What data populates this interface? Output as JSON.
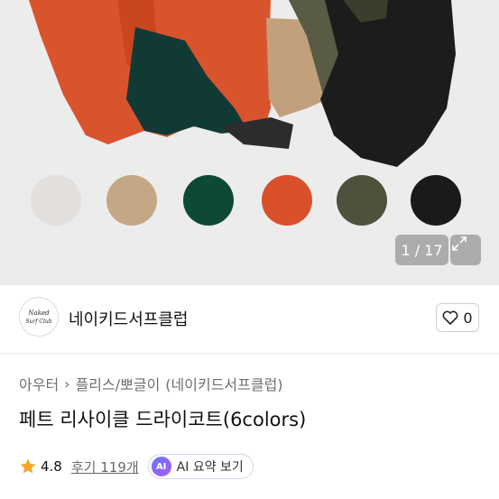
{
  "gallery": {
    "counter": "1 / 17",
    "swatches": [
      {
        "name": "light-gray",
        "color": "#e2dfdc"
      },
      {
        "name": "beige",
        "color": "#c4a784"
      },
      {
        "name": "green",
        "color": "#0e4a33"
      },
      {
        "name": "orange",
        "color": "#d9502b"
      },
      {
        "name": "khaki",
        "color": "#4e513c"
      },
      {
        "name": "black",
        "color": "#1a1a1a"
      }
    ],
    "expand_icon": "expand-icon"
  },
  "shop": {
    "name": "네이키드서프클럽",
    "logo_text": "Naked Surf Club",
    "like_count": "0"
  },
  "product": {
    "breadcrumb": [
      "아우터",
      "플리스/뽀글이",
      "(네이키드서프클럽)"
    ],
    "title": "페트 리사이클 드라이코트(6colors)",
    "rating": "4.8",
    "reviews_label": "후기 119개",
    "ai_badge": "AI",
    "ai_label": "AI 요약 보기"
  },
  "colors": {
    "star": "#f5a623",
    "ai_gradient_start": "#6b73ff",
    "ai_gradient_end": "#a75cf0"
  }
}
